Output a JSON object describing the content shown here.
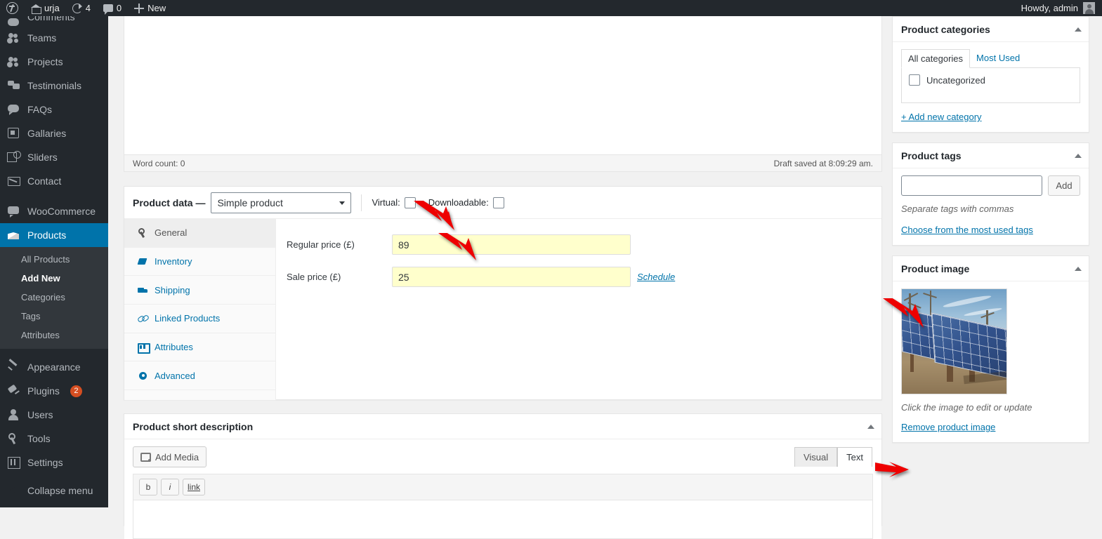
{
  "adminbar": {
    "logo_icon": "wordpress-logo-icon",
    "site_name": "urja",
    "home_icon": "home-icon",
    "updates_icon": "updates-icon",
    "updates_count": "4",
    "comments_icon": "comments-icon",
    "comments_count": "0",
    "new_icon": "plus-icon",
    "new_label": "New",
    "howdy": "Howdy, admin",
    "avatar_icon": "avatar-icon"
  },
  "sidebar": {
    "items": [
      {
        "label": "Comments",
        "icon": "comments-icon",
        "current": false,
        "partial": true
      },
      {
        "label": "Teams",
        "icon": "users-icon",
        "current": false
      },
      {
        "label": "Projects",
        "icon": "users-icon",
        "current": false
      },
      {
        "label": "Testimonials",
        "icon": "quote-icon",
        "current": false
      },
      {
        "label": "FAQs",
        "icon": "faq-icon",
        "current": false
      },
      {
        "label": "Gallaries",
        "icon": "gallery-icon",
        "current": false
      },
      {
        "label": "Sliders",
        "icon": "slider-icon",
        "current": false
      },
      {
        "label": "Contact",
        "icon": "mail-icon",
        "current": false
      },
      {
        "label": "WooCommerce",
        "icon": "woocommerce-icon",
        "current": false
      },
      {
        "label": "Products",
        "icon": "products-icon",
        "current": true
      }
    ],
    "submenu": [
      {
        "label": "All Products",
        "current": false
      },
      {
        "label": "Add New",
        "current": true
      },
      {
        "label": "Categories",
        "current": false
      },
      {
        "label": "Tags",
        "current": false
      },
      {
        "label": "Attributes",
        "current": false
      }
    ],
    "items_bottom": [
      {
        "label": "Appearance",
        "icon": "appearance-icon",
        "badge": ""
      },
      {
        "label": "Plugins",
        "icon": "plugins-icon",
        "badge": "2"
      },
      {
        "label": "Users",
        "icon": "user-icon",
        "badge": ""
      },
      {
        "label": "Tools",
        "icon": "tools-icon",
        "badge": ""
      },
      {
        "label": "Settings",
        "icon": "settings-icon",
        "badge": ""
      }
    ],
    "collapse_label": "Collapse menu",
    "collapse_icon": "collapse-icon",
    "current_color": "#0073aa",
    "badge_color": "#d54e21"
  },
  "editor": {
    "word_count": "Word count: 0",
    "draft_saved": "Draft saved at 8:09:29 am."
  },
  "product_data": {
    "title": "Product data —",
    "type_selected": "Simple product",
    "type_caret_icon": "chevron-down-icon",
    "virtual_label": "Virtual:",
    "virtual_checked": false,
    "downloadable_label": "Downloadable:",
    "downloadable_checked": false,
    "toggle_icon": "chevron-up-icon",
    "tabs": [
      {
        "label": "General",
        "icon": "wrench-icon",
        "active": true
      },
      {
        "label": "Inventory",
        "icon": "tag-icon",
        "active": false
      },
      {
        "label": "Shipping",
        "icon": "truck-icon",
        "active": false
      },
      {
        "label": "Linked Products",
        "icon": "link-icon",
        "active": false
      },
      {
        "label": "Attributes",
        "icon": "attributes-icon",
        "active": false
      },
      {
        "label": "Advanced",
        "icon": "gear-icon",
        "active": false
      }
    ],
    "fields": [
      {
        "label": "Regular price (£)",
        "value": "89",
        "highlight": "#ffffcc"
      },
      {
        "label": "Sale price (£)",
        "value": "25",
        "highlight": "#ffffcc"
      }
    ],
    "schedule_link": "Schedule"
  },
  "short_description": {
    "title": "Product short description",
    "toggle_icon": "chevron-up-icon",
    "add_media_label": "Add Media",
    "add_media_icon": "media-icon",
    "editor_tabs": [
      {
        "label": "Visual",
        "active": false
      },
      {
        "label": "Text",
        "active": true
      }
    ],
    "quicktags": [
      "b",
      "i",
      "link"
    ]
  },
  "side": {
    "categories": {
      "title": "Product categories",
      "toggle_icon": "chevron-up-icon",
      "tabs": [
        {
          "label": "All categories",
          "active": true
        },
        {
          "label": "Most Used",
          "active": false
        }
      ],
      "items": [
        {
          "label": "Uncategorized",
          "checked": false
        }
      ],
      "add_link": "+ Add new category"
    },
    "tags": {
      "title": "Product tags",
      "toggle_icon": "chevron-up-icon",
      "input_value": "",
      "add_button": "Add",
      "hint": "Separate tags with commas",
      "most_used_link": "Choose from the most used tags"
    },
    "image": {
      "title": "Product image",
      "toggle_icon": "chevron-up-icon",
      "thumbnail_alt": "solar-panel-array-photo",
      "hint": "Click the image to edit or update",
      "remove_link": "Remove product image"
    }
  },
  "annotations": {
    "arrow_color": "#ee0000",
    "arrows": [
      {
        "name": "arrow-regular-price"
      },
      {
        "name": "arrow-sale-price"
      },
      {
        "name": "arrow-product-image"
      },
      {
        "name": "arrow-remove-product-image"
      }
    ]
  }
}
